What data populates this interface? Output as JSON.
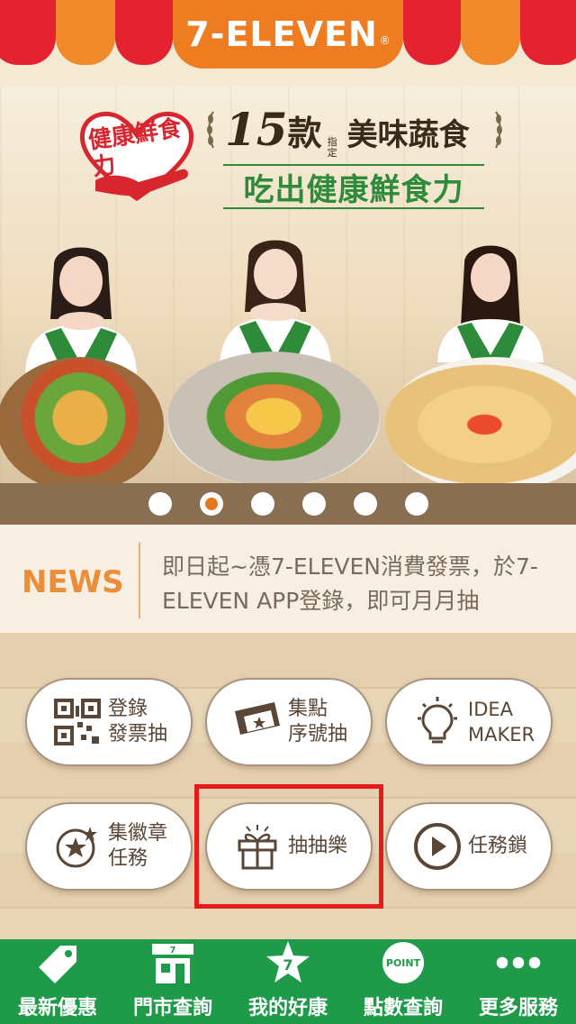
{
  "header": {
    "logo": "7-ELEVEN",
    "logo_reg": "®"
  },
  "banner": {
    "badge_text": "健康鮮食力",
    "title_num": "15",
    "title_kuan": "款",
    "title_tag": "指定",
    "title_rest": "美味蔬食",
    "subtitle": "吃出健康鮮食力",
    "slides_total": 6,
    "active_slide": 2
  },
  "news": {
    "label": "NEWS",
    "text": "即日起~憑7-ELEVEN消費發票，於7-ELEVEN APP登錄，即可月月抽"
  },
  "buttons": [
    {
      "label_line1": "登錄",
      "label_line2": "發票抽",
      "icon": "qr-code-icon"
    },
    {
      "label_line1": "集點",
      "label_line2": "序號抽",
      "icon": "ticket-icon"
    },
    {
      "label_line1": "IDEA",
      "label_line2": "MAKER",
      "icon": "lightbulb-icon"
    },
    {
      "label_line1": "集徽章",
      "label_line2": "任務",
      "icon": "badge-star-icon"
    },
    {
      "label_line1": "抽抽樂",
      "label_line2": "",
      "icon": "gift-icon"
    },
    {
      "label_line1": "任務鎖",
      "label_line2": "",
      "icon": "play-icon"
    }
  ],
  "nav": [
    {
      "label": "最新優惠",
      "icon": "tag-icon"
    },
    {
      "label": "門市查詢",
      "icon": "store-icon"
    },
    {
      "label": "我的好康",
      "icon": "star-7-icon"
    },
    {
      "label": "點數查詢",
      "icon": "point-icon"
    },
    {
      "label": "更多服務",
      "icon": "more-dots-icon"
    }
  ],
  "colors": {
    "brand_orange": "#ee7d22",
    "brand_red": "#e52330",
    "brand_green": "#1e9a48",
    "highlight": "#e51b1b"
  }
}
